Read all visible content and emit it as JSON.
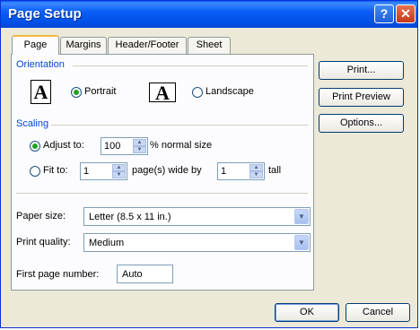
{
  "window": {
    "title": "Page Setup",
    "help_glyph": "?",
    "close_glyph": "✕"
  },
  "tabs": [
    {
      "label": "Page"
    },
    {
      "label": "Margins"
    },
    {
      "label": "Header/Footer"
    },
    {
      "label": "Sheet"
    }
  ],
  "orientation": {
    "section_label": "Orientation",
    "portrait_label": "Portrait",
    "landscape_label": "Landscape",
    "selected": "Portrait",
    "icon_glyph": "A"
  },
  "scaling": {
    "section_label": "Scaling",
    "adjust_label": "Adjust to:",
    "adjust_value": "100",
    "adjust_suffix": "% normal size",
    "fit_label": "Fit to:",
    "fit_wide_value": "1",
    "fit_wide_suffix": "page(s) wide by",
    "fit_tall_value": "1",
    "fit_tall_suffix": "tall",
    "selected": "Adjust to:"
  },
  "paper_size": {
    "label": "Paper size:",
    "value": "Letter (8.5 x 11 in.)"
  },
  "print_quality": {
    "label": "Print quality:",
    "value": "Medium"
  },
  "first_page": {
    "label": "First page number:",
    "value": "Auto"
  },
  "side_buttons": {
    "print": "Print...",
    "print_preview": "Print Preview",
    "options": "Options..."
  },
  "footer": {
    "ok": "OK",
    "cancel": "Cancel"
  }
}
